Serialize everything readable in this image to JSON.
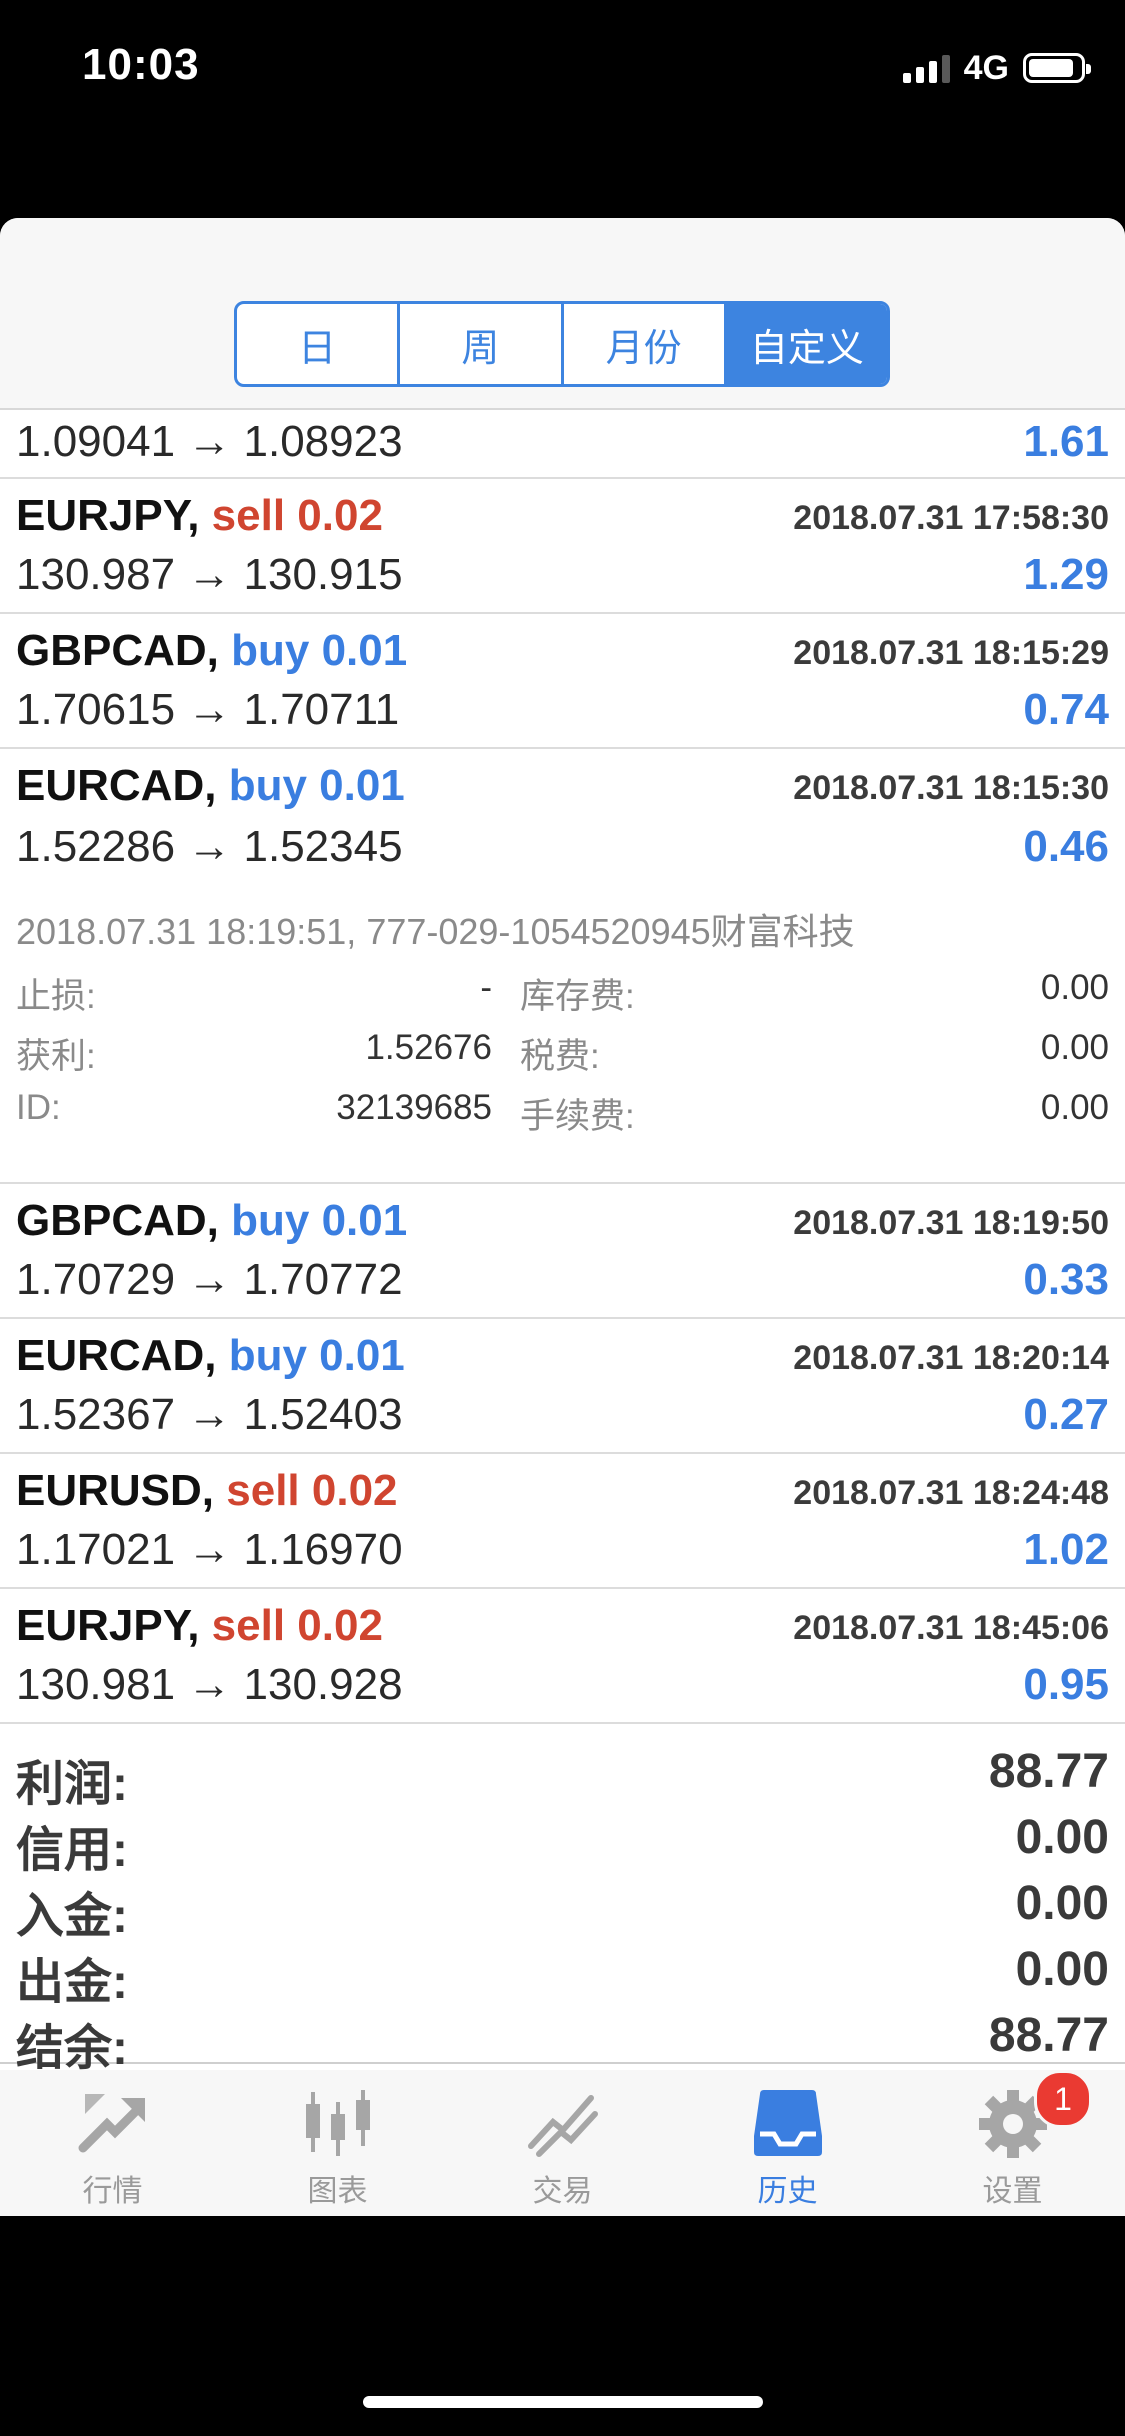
{
  "status": {
    "time": "10:03",
    "network": "4G"
  },
  "segments": [
    {
      "label": "日",
      "active": false
    },
    {
      "label": "周",
      "active": false
    },
    {
      "label": "月份",
      "active": false
    },
    {
      "label": "自定义",
      "active": true
    }
  ],
  "first_row": {
    "prices": "1.09041 → 1.08923",
    "profit": "1.61"
  },
  "deals_a": [
    {
      "symbol": "EURJPY,",
      "type": "sell 0.02",
      "date": "2018.07.31 17:58:30",
      "prices": "130.987 → 130.915",
      "profit": "1.29"
    },
    {
      "symbol": "GBPCAD,",
      "type": "buy 0.01",
      "date": "2018.07.31 18:15:29",
      "prices": "1.70615 → 1.70711",
      "profit": "0.74"
    },
    {
      "symbol": "EURCAD,",
      "type": "buy 0.01",
      "date": "2018.07.31 18:15:30",
      "prices": "1.52286 → 1.52345",
      "profit": "0.46"
    }
  ],
  "detail": {
    "header": "2018.07.31 18:19:51, 777-029-1054520945财富科技",
    "stop_loss_label": "止损:",
    "stop_loss_value": "-",
    "swap_label": "库存费:",
    "swap_value": "0.00",
    "take_profit_label": "获利:",
    "take_profit_value": "1.52676",
    "tax_label": "税费:",
    "tax_value": "0.00",
    "id_label": "ID:",
    "id_value": "32139685",
    "commission_label": "手续费:",
    "commission_value": "0.00"
  },
  "deals_b": [
    {
      "symbol": "GBPCAD,",
      "type": "buy 0.01",
      "date": "2018.07.31 18:19:50",
      "prices": "1.70729 → 1.70772",
      "profit": "0.33"
    },
    {
      "symbol": "EURCAD,",
      "type": "buy 0.01",
      "date": "2018.07.31 18:20:14",
      "prices": "1.52367 → 1.52403",
      "profit": "0.27"
    },
    {
      "symbol": "EURUSD,",
      "type": "sell 0.02",
      "date": "2018.07.31 18:24:48",
      "prices": "1.17021 → 1.16970",
      "profit": "1.02"
    },
    {
      "symbol": "EURJPY,",
      "type": "sell 0.02",
      "date": "2018.07.31 18:45:06",
      "prices": "130.981 → 130.928",
      "profit": "0.95"
    }
  ],
  "summary": [
    {
      "label": "利润:",
      "value": "88.77"
    },
    {
      "label": "信用:",
      "value": "0.00"
    },
    {
      "label": "入金:",
      "value": "0.00"
    },
    {
      "label": "出金:",
      "value": "0.00"
    },
    {
      "label": "结余:",
      "value": "88.77"
    }
  ],
  "tabs": [
    {
      "label": "行情",
      "icon": "quotes-icon",
      "active": false
    },
    {
      "label": "图表",
      "icon": "chart-icon",
      "active": false
    },
    {
      "label": "交易",
      "icon": "trade-icon",
      "active": false
    },
    {
      "label": "历史",
      "icon": "history-icon",
      "active": true
    },
    {
      "label": "设置",
      "icon": "settings-icon",
      "active": false,
      "badge": "1"
    }
  ],
  "colors": {
    "accent": "#3a7ee0",
    "sell": "#d04530",
    "badge": "#ea3a32"
  }
}
